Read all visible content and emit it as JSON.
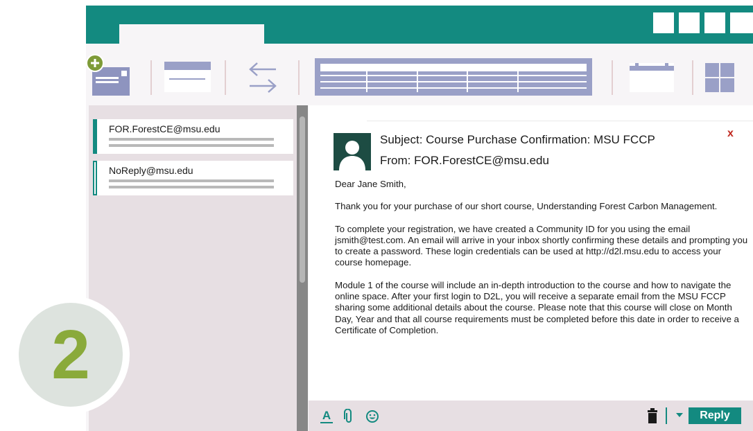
{
  "window": {
    "window_buttons": [
      "window-button",
      "window-button",
      "window-button"
    ],
    "accent_color": "#138a80"
  },
  "toolbar": {
    "icons": [
      "new-message-icon",
      "message-view-icon",
      "swap-arrows-icon",
      "search-lines-icon",
      "calendar-icon",
      "grid-view-icon"
    ]
  },
  "inbox": {
    "items": [
      {
        "sender": "FOR.ForestCE@msu.edu",
        "selected": true
      },
      {
        "sender": "NoReply@msu.edu",
        "selected": false
      }
    ]
  },
  "message": {
    "subject": "Subject: Course Purchase Confirmation: MSU FCCP",
    "from": "From: FOR.ForestCE@msu.edu",
    "close_label": "x",
    "body": [
      "Dear Jane Smith,",
      "Thank you for your purchase of our short course, Understanding Forest Carbon Management.",
      "To complete your registration, we have created a Community ID for you using the email jsmith@test.com. An email will arrive in your inbox shortly confirming these details and prompting you to create a password. These login credentials can be used at http://d2l.msu.edu to access your course homepage.",
      "Module 1 of the course will include an in-depth introduction to the course and how to navigate the online space. After your first login to D2L, you will receive a separate email from the MSU FCCP sharing some additional details about the course. Please note that this course will close on Month Day, Year and that all course requirements must be completed before this date in order to receive a Certificate of Completion."
    ]
  },
  "reply_bar": {
    "format_label": "A",
    "reply_label": "Reply",
    "icons": [
      "text-format-icon",
      "attachment-icon",
      "emoji-icon",
      "trash-icon",
      "dropdown-arrow-icon"
    ]
  },
  "step": {
    "number": "2",
    "color": "#8aaa3b"
  }
}
